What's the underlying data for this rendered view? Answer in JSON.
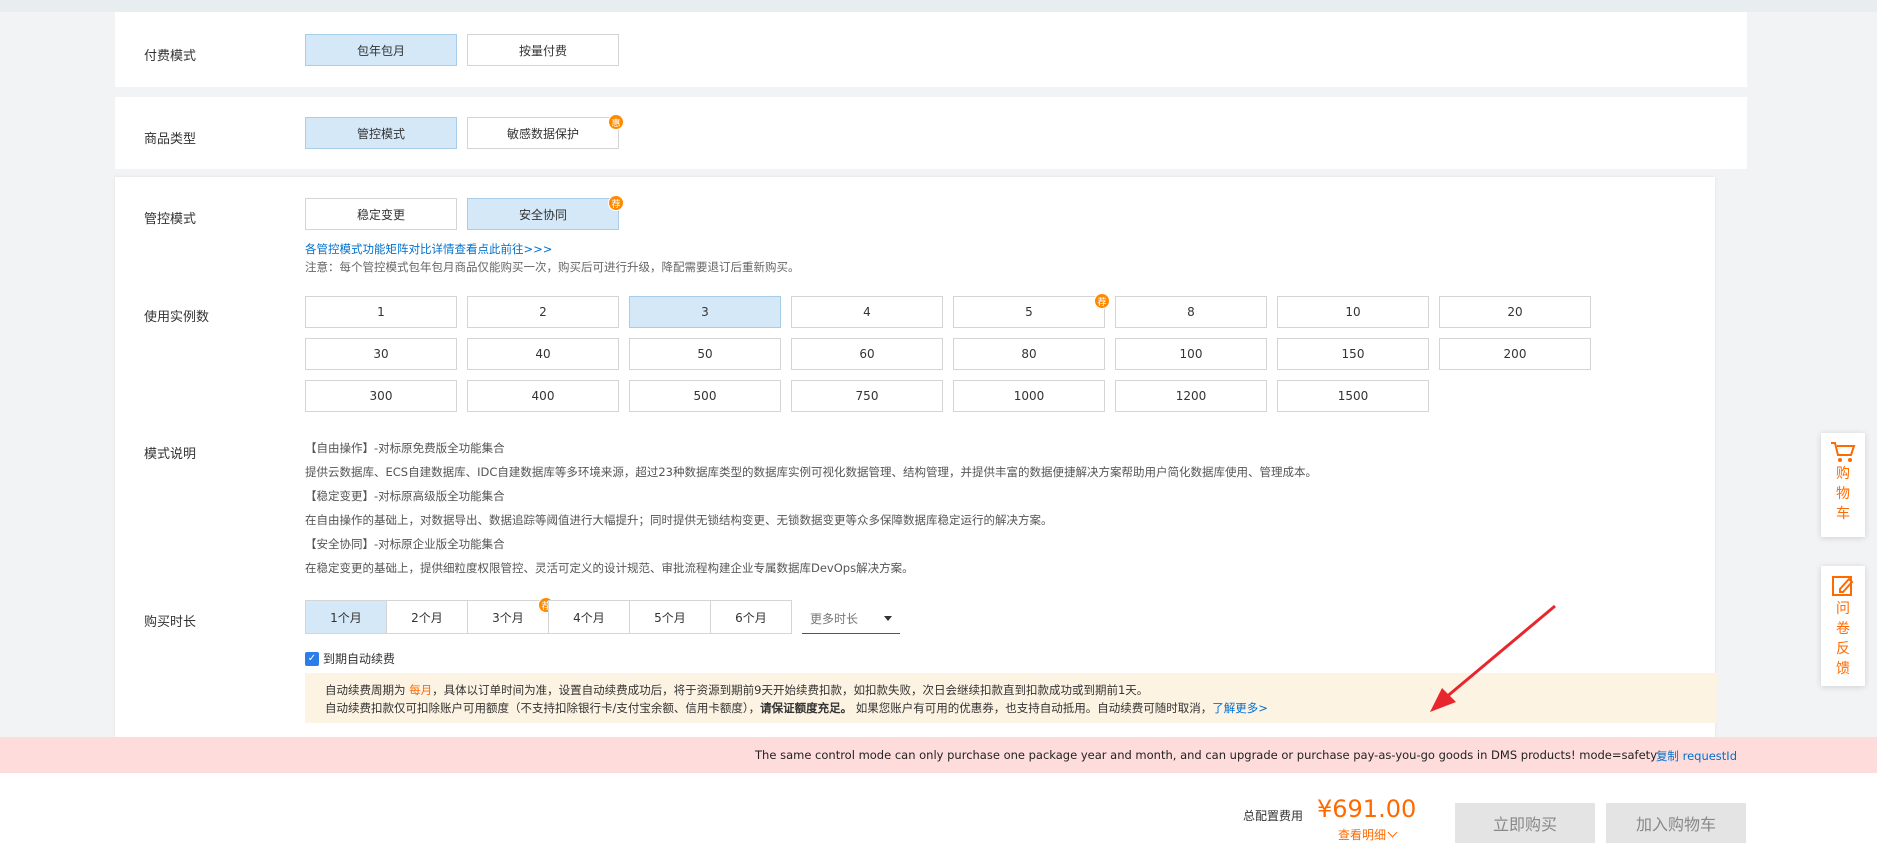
{
  "billing": {
    "label": "付费模式",
    "options": [
      "包年包月",
      "按量付费"
    ]
  },
  "product": {
    "label": "商品类型",
    "options": [
      "管控模式",
      "敏感数据保护"
    ],
    "badge": "惠"
  },
  "control": {
    "label": "管控模式",
    "options": [
      "稳定变更",
      "安全协同"
    ],
    "badge": "荐",
    "link": "各管控模式功能矩阵对比详情查看点此前往>>>",
    "notice": "注意：每个管控模式包年包月商品仅能购买一次，购买后可进行升级，降配需要退订后重新购买。"
  },
  "instances": {
    "label": "使用实例数",
    "badge": "荐",
    "values": [
      "1",
      "2",
      "3",
      "4",
      "5",
      "8",
      "10",
      "20",
      "30",
      "40",
      "50",
      "60",
      "80",
      "100",
      "150",
      "200",
      "300",
      "400",
      "500",
      "750",
      "1000",
      "1200",
      "1500"
    ]
  },
  "mode_desc": {
    "label": "模式说明",
    "lines": [
      "【自由操作】-对标原免费版全功能集合",
      "提供云数据库、ECS自建数据库、IDC自建数据库等多环境来源，超过23种数据库类型的数据库实例可视化数据管理、结构管理，并提供丰富的数据便捷解决方案帮助用户简化数据库使用、管理成本。",
      "【稳定变更】-对标原高级版全功能集合",
      "在自由操作的基础上，对数据导出、数据追踪等阈值进行大幅提升；同时提供无锁结构变更、无锁数据变更等众多保障数据库稳定运行的解决方案。",
      "【安全协同】-对标原企业版全功能集合",
      "在稳定变更的基础上，提供细粒度权限管控、灵活可定义的设计规范、审批流程构建企业专属数据库DevOps解决方案。"
    ]
  },
  "duration": {
    "label": "购买时长",
    "options": [
      "1个月",
      "2个月",
      "3个月",
      "4个月",
      "5个月",
      "6个月"
    ],
    "badge": "荐",
    "more": "更多时长"
  },
  "auto_renew": {
    "label": "到期自动续费",
    "line1_a": "自动续费周期为 ",
    "line1_period": "每月",
    "line1_b": "，具体以订单时间为准，设置自动续费成功后，将于资源到期前9天开始续费扣款，如扣款失败，次日会继续扣款直到扣款成功或到期前1天。",
    "line2_a": "自动续费扣款仅可扣除账户可用额度（不支持扣除银行卡/支付宝余额、信用卡额度），",
    "line2_bold": "请保证额度充足。",
    "line2_b": " 如果您账户有可用的优惠券，也支持自动抵用。自动续费可随时取消，",
    "line2_link": "了解更多>"
  },
  "error": {
    "message": "The same control mode can only purchase one package year and month, and can upgrade or purchase pay-as-you-go goods in DMS products! mode=safety",
    "copy": "复制 requestId"
  },
  "footer": {
    "total_label": "总配置费用",
    "price": "¥691.00",
    "detail": "查看明细",
    "buy": "立即购买",
    "cart": "加入购物车"
  },
  "sidebar": {
    "cart": [
      "购",
      "物",
      "车"
    ],
    "feedback": [
      "问",
      "卷",
      "反",
      "馈"
    ]
  },
  "colors": {
    "accent": "#ff6a00",
    "selected_bg": "#d4e8f8",
    "error_bg": "#ffdcdc",
    "link": "#0070cc"
  }
}
